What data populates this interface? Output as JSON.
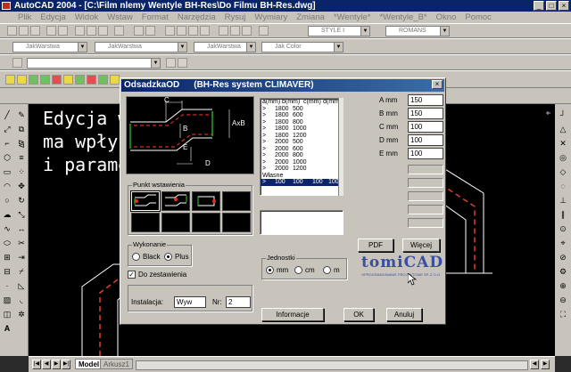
{
  "window": {
    "title": "AutoCAD 2004 - [C:\\Film nlemy Wentyle BH-Res\\Do Filmu BH-Res.dwg]"
  },
  "menu": [
    "Plik",
    "Edycja",
    "Widok",
    "Wstaw",
    "Format",
    "Narzędzia",
    "Rysuj",
    "Wymiary",
    "Zmiana",
    "*Wentyle*",
    "*Wentyle_B*",
    "Okno",
    "Pomoc"
  ],
  "toolbars": {
    "style_combo": "STYLE I",
    "font_combo": "ROMANS",
    "layer_combo": "JakWarstwa",
    "linetype_combo": "JakWarstwa",
    "lineweight_combo": "JakWarstwa",
    "color_combo": "Jak Color"
  },
  "canvas": {
    "text_lines": [
      "Edycja w",
      "ma wpły",
      "i parame"
    ]
  },
  "tabs": {
    "model": "Model",
    "layout": "Arkusz1"
  },
  "dialog": {
    "title": "OdsadzkaOD",
    "subtitle": "(BH-Res system CLIMAVER)",
    "diagram_labels": {
      "c": "C",
      "b": "B",
      "axb": "AxB",
      "e": "E",
      "d": "D"
    },
    "table": {
      "headers": [
        "a(mm)",
        "b(mm)",
        "c(mm)",
        "d(mm)"
      ],
      "rows": [
        {
          "a": "1800",
          "b": "500",
          "c": "",
          "d": ""
        },
        {
          "a": "1800",
          "b": "600",
          "c": "",
          "d": ""
        },
        {
          "a": "1800",
          "b": "800",
          "c": "",
          "d": ""
        },
        {
          "a": "1800",
          "b": "1000",
          "c": "",
          "d": ""
        },
        {
          "a": "1800",
          "b": "1200",
          "c": "",
          "d": ""
        },
        {
          "a": "2000",
          "b": "500",
          "c": "",
          "d": ""
        },
        {
          "a": "2000",
          "b": "600",
          "c": "",
          "d": ""
        },
        {
          "a": "2000",
          "b": "800",
          "c": "",
          "d": ""
        },
        {
          "a": "2000",
          "b": "1000",
          "c": "",
          "d": ""
        },
        {
          "a": "2000",
          "b": "1200",
          "c": "",
          "d": ""
        }
      ],
      "section_label": "Własne",
      "selected_row": {
        "a": "100",
        "b": "100",
        "c": "100",
        "d": "100"
      }
    },
    "dims": [
      {
        "label": "A mm",
        "value": "150"
      },
      {
        "label": "B mm",
        "value": "150"
      },
      {
        "label": "C mm",
        "value": "100"
      },
      {
        "label": "D mm",
        "value": "100"
      },
      {
        "label": "E mm",
        "value": "100"
      }
    ],
    "insertion_group": "Punkt wstawienia",
    "execution": {
      "label": "Wykonanie",
      "options": [
        "Black",
        "Plus"
      ],
      "selected": "Plus"
    },
    "bom_checkbox": {
      "label": "Do zestawienia",
      "checked": true
    },
    "installation": {
      "label": "Instalacja:",
      "value": "Wyw",
      "nr_label": "Nr:",
      "nr_value": "2"
    },
    "units": {
      "label": "Jednostki",
      "options": [
        "mm",
        "cm",
        "m"
      ],
      "selected": "mm"
    },
    "buttons": {
      "pdf": "PDF",
      "more": "Więcej",
      "info": "Informacje",
      "ok": "OK",
      "cancel": "Anuluj"
    },
    "logo": {
      "name": "tomiCAD",
      "tagline": "OPROGRAMOWANIE PROJEKTOWE SP. Z O.O."
    }
  }
}
